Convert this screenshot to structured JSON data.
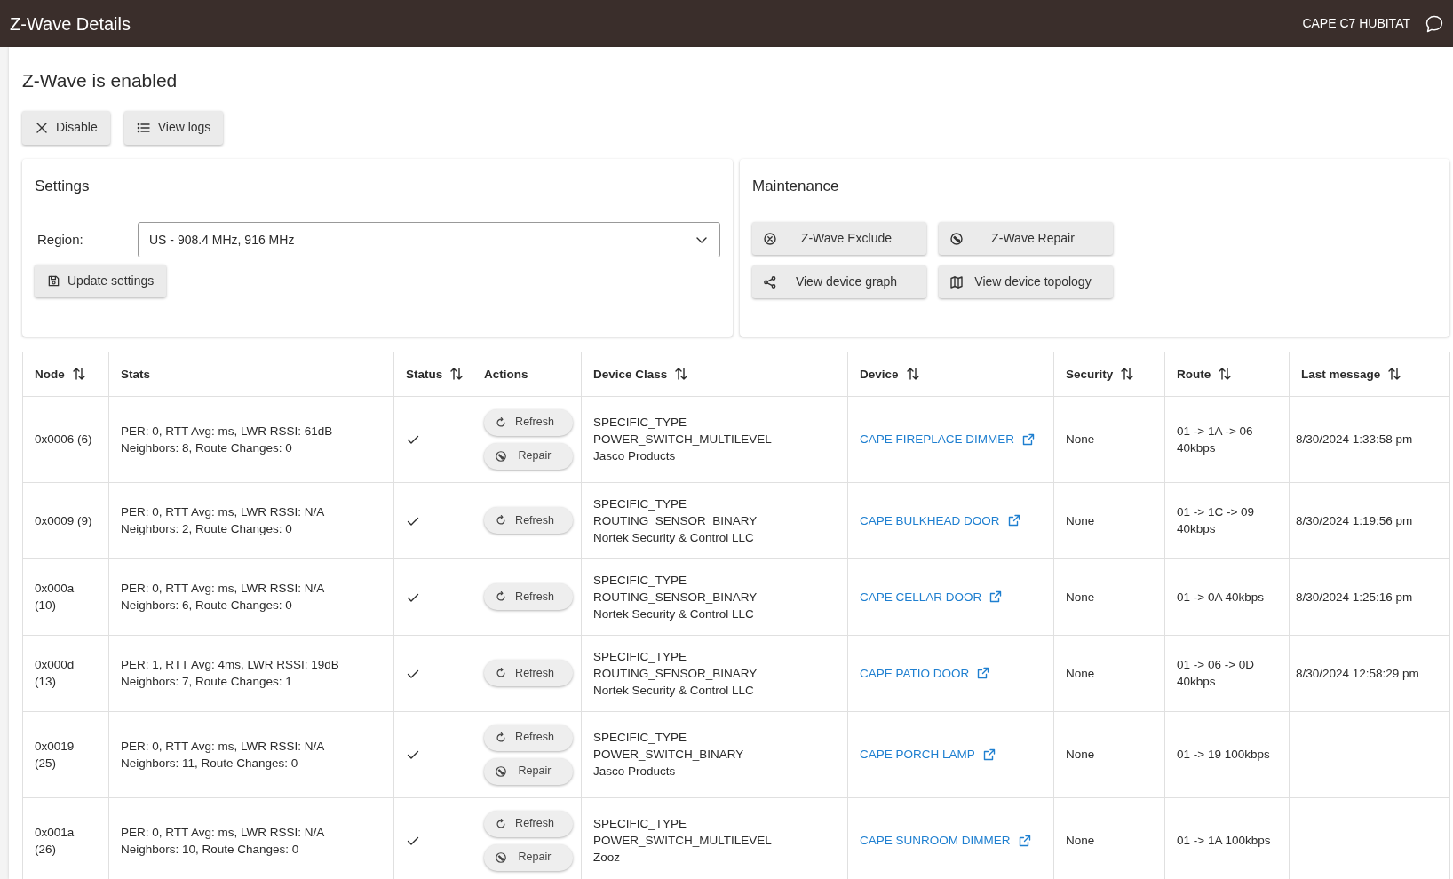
{
  "app_bar": {
    "title": "Z-Wave Details",
    "hub_name": "CAPE C7 HUBITAT"
  },
  "status_heading": "Z-Wave is enabled",
  "toolbar": [
    {
      "kind": "disable",
      "label": "Disable"
    },
    {
      "kind": "logs",
      "label": "View logs"
    }
  ],
  "settings": {
    "title": "Settings",
    "region_label": "Region:",
    "region_value": "US - 908.4 MHz, 916 MHz",
    "button": {
      "kind": "save",
      "label": "Update settings"
    }
  },
  "maintenance": {
    "title": "Maintenance",
    "buttons": [
      {
        "kind": "exclude",
        "label": "Z-Wave Exclude"
      },
      {
        "kind": "repair",
        "label": "Z-Wave Repair"
      },
      {
        "kind": "graph",
        "label": "View device graph"
      },
      {
        "kind": "topology",
        "label": "View device topology"
      }
    ]
  },
  "table": {
    "columns": [
      {
        "label": "Node",
        "sortable": true
      },
      {
        "label": "Stats",
        "sortable": false
      },
      {
        "label": "Status",
        "sortable": true
      },
      {
        "label": "Actions",
        "sortable": false
      },
      {
        "label": "Device Class",
        "sortable": true
      },
      {
        "label": "Device",
        "sortable": true
      },
      {
        "label": "Security",
        "sortable": true
      },
      {
        "label": "Route",
        "sortable": true
      },
      {
        "label": "Last message",
        "sortable": true
      }
    ],
    "rows": [
      {
        "node": "0x0006 (6)",
        "stats": [
          "PER: 0, RTT Avg: ms, LWR RSSI: 61dB",
          "Neighbors: 8, Route Changes: 0"
        ],
        "online": true,
        "actions": [
          {
            "kind": "refresh",
            "label": "Refresh"
          },
          {
            "kind": "repair",
            "label": "Repair"
          }
        ],
        "device_class": [
          "SPECIFIC_TYPE",
          "POWER_SWITCH_MULTILEVEL",
          "Jasco Products"
        ],
        "device": "CAPE FIREPLACE DIMMER",
        "security": "None",
        "route": "01 -> 1A -> 06 40kbps",
        "last_message": "8/30/2024 1:33:58 pm"
      },
      {
        "node": "0x0009 (9)",
        "stats": [
          "PER: 0, RTT Avg: ms, LWR RSSI: N/A",
          "Neighbors: 2, Route Changes: 0"
        ],
        "online": true,
        "actions": [
          {
            "kind": "refresh",
            "label": "Refresh"
          }
        ],
        "device_class": [
          "SPECIFIC_TYPE",
          "ROUTING_SENSOR_BINARY",
          "Nortek Security & Control LLC"
        ],
        "device": "CAPE BULKHEAD DOOR",
        "security": "None",
        "route": "01 -> 1C -> 09 40kbps",
        "last_message": "8/30/2024 1:19:56 pm"
      },
      {
        "node": "0x000a (10)",
        "stats": [
          "PER: 0, RTT Avg: ms, LWR RSSI: N/A",
          "Neighbors: 6, Route Changes: 0"
        ],
        "online": true,
        "actions": [
          {
            "kind": "refresh",
            "label": "Refresh"
          }
        ],
        "device_class": [
          "SPECIFIC_TYPE",
          "ROUTING_SENSOR_BINARY",
          "Nortek Security & Control LLC"
        ],
        "device": "CAPE CELLAR DOOR",
        "security": "None",
        "route": "01 -> 0A 40kbps",
        "last_message": "8/30/2024 1:25:16 pm"
      },
      {
        "node": "0x000d (13)",
        "stats": [
          "PER: 1, RTT Avg: 4ms, LWR RSSI: 19dB",
          "Neighbors: 7, Route Changes: 1"
        ],
        "online": true,
        "actions": [
          {
            "kind": "refresh",
            "label": "Refresh"
          }
        ],
        "device_class": [
          "SPECIFIC_TYPE",
          "ROUTING_SENSOR_BINARY",
          "Nortek Security & Control LLC"
        ],
        "device": "CAPE PATIO DOOR",
        "security": "None",
        "route": "01 -> 06 -> 0D 40kbps",
        "last_message": "8/30/2024 12:58:29 pm"
      },
      {
        "node": "0x0019 (25)",
        "stats": [
          "PER: 0, RTT Avg: ms, LWR RSSI: N/A",
          "Neighbors: 11, Route Changes: 0"
        ],
        "online": true,
        "actions": [
          {
            "kind": "refresh",
            "label": "Refresh"
          },
          {
            "kind": "repair",
            "label": "Repair"
          }
        ],
        "device_class": [
          "SPECIFIC_TYPE POWER_SWITCH_BINARY",
          "Jasco Products"
        ],
        "device": "CAPE PORCH LAMP",
        "security": "None",
        "route": "01 -> 19 100kbps"
      },
      {
        "node": "0x001a (26)",
        "stats": [
          "PER: 0, RTT Avg: ms, LWR RSSI: N/A",
          "Neighbors: 10, Route Changes: 0"
        ],
        "online": true,
        "actions": [
          {
            "kind": "refresh",
            "label": "Refresh"
          },
          {
            "kind": "repair",
            "label": "Repair"
          }
        ],
        "device_class": [
          "SPECIFIC_TYPE",
          "POWER_SWITCH_MULTILEVEL",
          "Zooz"
        ],
        "device": "CAPE SUNROOM DIMMER",
        "security": "None",
        "route": "01 -> 1A 100kbps"
      }
    ]
  }
}
